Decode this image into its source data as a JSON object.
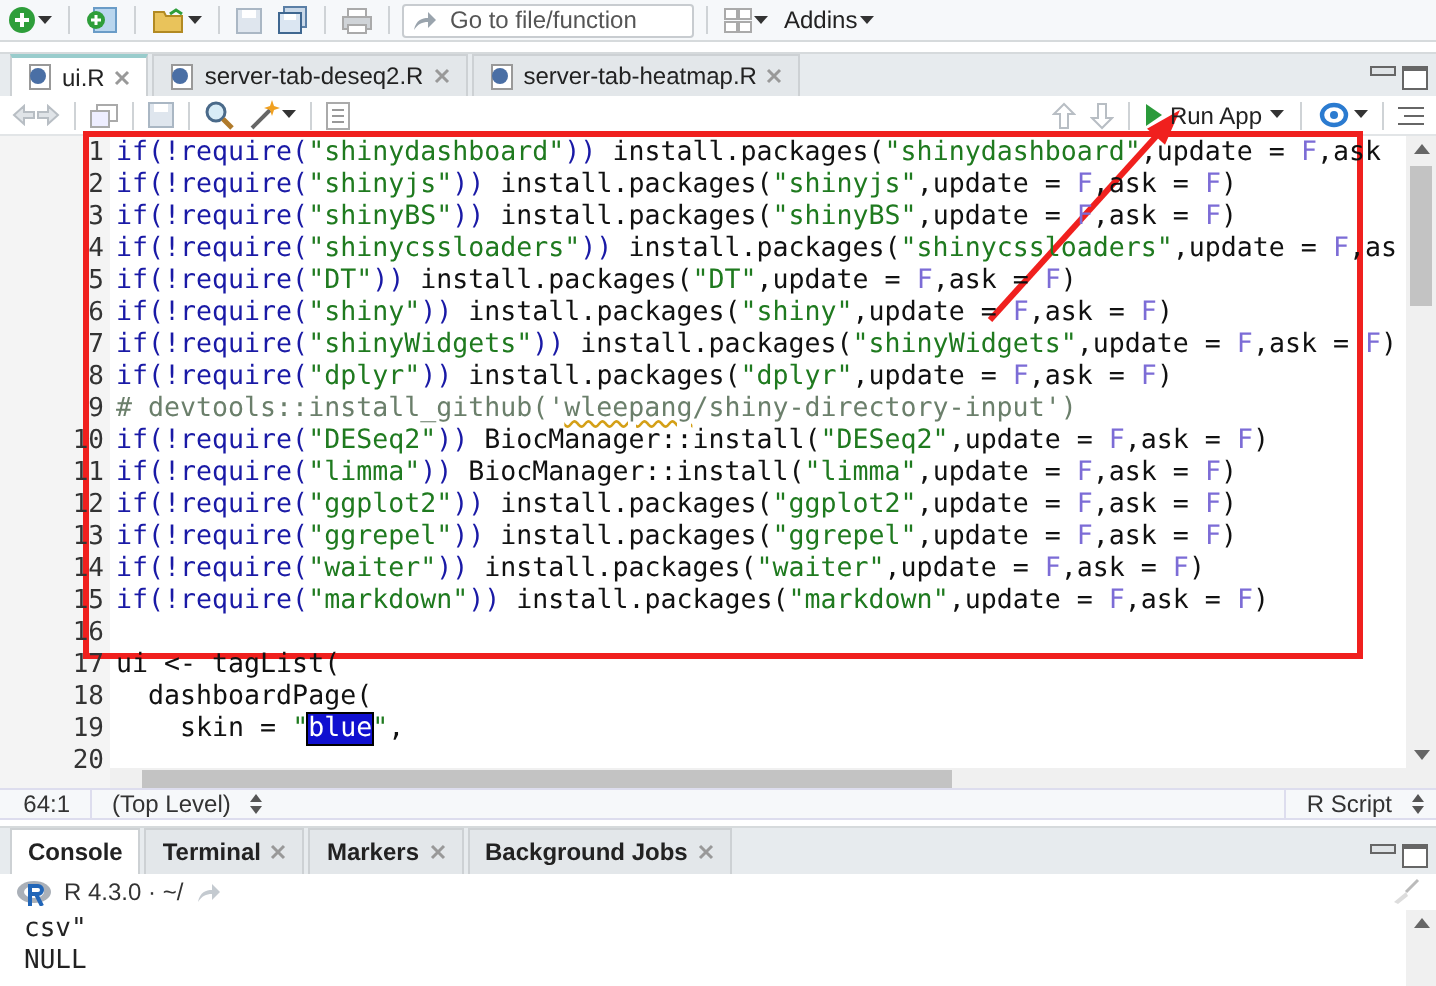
{
  "toolbar": {
    "goto_placeholder": "Go to file/function",
    "addins": "Addins"
  },
  "editor_tabs": [
    {
      "label": "ui.R",
      "selected": true
    },
    {
      "label": "server-tab-deseq2.R",
      "selected": false
    },
    {
      "label": "server-tab-heatmap.R",
      "selected": false
    }
  ],
  "editor_toolbar": {
    "run_app": "Run App"
  },
  "code_lines": [
    {
      "number": "1",
      "segments": [
        {
          "kind": "keyword",
          "text": "if(!require("
        },
        {
          "kind": "string",
          "text": "\"shinydashboard\""
        },
        {
          "kind": "keyword",
          "text": "))"
        },
        {
          "kind": "plain",
          "text": " install.packages("
        },
        {
          "kind": "string",
          "text": "\"shinydashboard\""
        },
        {
          "kind": "plain",
          "text": ",update = "
        },
        {
          "kind": "constant",
          "text": "F"
        },
        {
          "kind": "plain",
          "text": ",ask"
        }
      ]
    },
    {
      "number": "2",
      "segments": [
        {
          "kind": "keyword",
          "text": "if(!require("
        },
        {
          "kind": "string",
          "text": "\"shinyjs\""
        },
        {
          "kind": "keyword",
          "text": "))"
        },
        {
          "kind": "plain",
          "text": " install.packages("
        },
        {
          "kind": "string",
          "text": "\"shinyjs\""
        },
        {
          "kind": "plain",
          "text": ",update = "
        },
        {
          "kind": "constant",
          "text": "F"
        },
        {
          "kind": "plain",
          "text": ",ask = "
        },
        {
          "kind": "constant",
          "text": "F"
        },
        {
          "kind": "plain",
          "text": ")"
        }
      ]
    },
    {
      "number": "3",
      "segments": [
        {
          "kind": "keyword",
          "text": "if(!require("
        },
        {
          "kind": "string",
          "text": "\"shinyBS\""
        },
        {
          "kind": "keyword",
          "text": "))"
        },
        {
          "kind": "plain",
          "text": " install.packages("
        },
        {
          "kind": "string",
          "text": "\"shinyBS\""
        },
        {
          "kind": "plain",
          "text": ",update = "
        },
        {
          "kind": "constant",
          "text": "F"
        },
        {
          "kind": "plain",
          "text": ",ask = "
        },
        {
          "kind": "constant",
          "text": "F"
        },
        {
          "kind": "plain",
          "text": ")"
        }
      ]
    },
    {
      "number": "4",
      "segments": [
        {
          "kind": "keyword",
          "text": "if(!require("
        },
        {
          "kind": "string",
          "text": "\"shinycssloaders\""
        },
        {
          "kind": "keyword",
          "text": "))"
        },
        {
          "kind": "plain",
          "text": " install.packages("
        },
        {
          "kind": "string",
          "text": "\"shinycssloaders\""
        },
        {
          "kind": "plain",
          "text": ",update = "
        },
        {
          "kind": "constant",
          "text": "F"
        },
        {
          "kind": "plain",
          "text": ",as"
        }
      ]
    },
    {
      "number": "5",
      "segments": [
        {
          "kind": "keyword",
          "text": "if(!require("
        },
        {
          "kind": "string",
          "text": "\"DT\""
        },
        {
          "kind": "keyword",
          "text": "))"
        },
        {
          "kind": "plain",
          "text": " install.packages("
        },
        {
          "kind": "string",
          "text": "\"DT\""
        },
        {
          "kind": "plain",
          "text": ",update = "
        },
        {
          "kind": "constant",
          "text": "F"
        },
        {
          "kind": "plain",
          "text": ",ask = "
        },
        {
          "kind": "constant",
          "text": "F"
        },
        {
          "kind": "plain",
          "text": ")"
        }
      ]
    },
    {
      "number": "6",
      "segments": [
        {
          "kind": "keyword",
          "text": "if(!require("
        },
        {
          "kind": "string",
          "text": "\"shiny\""
        },
        {
          "kind": "keyword",
          "text": "))"
        },
        {
          "kind": "plain",
          "text": " install.packages("
        },
        {
          "kind": "string",
          "text": "\"shiny\""
        },
        {
          "kind": "plain",
          "text": ",update = "
        },
        {
          "kind": "constant",
          "text": "F"
        },
        {
          "kind": "plain",
          "text": ",ask = "
        },
        {
          "kind": "constant",
          "text": "F"
        },
        {
          "kind": "plain",
          "text": ")"
        }
      ]
    },
    {
      "number": "7",
      "segments": [
        {
          "kind": "keyword",
          "text": "if(!require("
        },
        {
          "kind": "string",
          "text": "\"shinyWidgets\""
        },
        {
          "kind": "keyword",
          "text": "))"
        },
        {
          "kind": "plain",
          "text": " install.packages("
        },
        {
          "kind": "string",
          "text": "\"shinyWidgets\""
        },
        {
          "kind": "plain",
          "text": ",update = "
        },
        {
          "kind": "constant",
          "text": "F"
        },
        {
          "kind": "plain",
          "text": ",ask = "
        },
        {
          "kind": "constant",
          "text": "F"
        },
        {
          "kind": "plain",
          "text": ")"
        }
      ]
    },
    {
      "number": "8",
      "segments": [
        {
          "kind": "keyword",
          "text": "if(!require("
        },
        {
          "kind": "string",
          "text": "\"dplyr\""
        },
        {
          "kind": "keyword",
          "text": "))"
        },
        {
          "kind": "plain",
          "text": " install.packages("
        },
        {
          "kind": "string",
          "text": "\"dplyr\""
        },
        {
          "kind": "plain",
          "text": ",update = "
        },
        {
          "kind": "constant",
          "text": "F"
        },
        {
          "kind": "plain",
          "text": ",ask = "
        },
        {
          "kind": "constant",
          "text": "F"
        },
        {
          "kind": "plain",
          "text": ")"
        }
      ]
    },
    {
      "number": "9",
      "segments": [
        {
          "kind": "comment",
          "text": "# devtools::install_github('"
        },
        {
          "kind": "misspelled",
          "text": "wleepang"
        },
        {
          "kind": "comment",
          "text": "/shiny-directory-input')"
        }
      ]
    },
    {
      "number": "10",
      "segments": [
        {
          "kind": "keyword",
          "text": "if(!require("
        },
        {
          "kind": "string",
          "text": "\"DESeq2\""
        },
        {
          "kind": "keyword",
          "text": "))"
        },
        {
          "kind": "plain",
          "text": " BiocManager::install("
        },
        {
          "kind": "string",
          "text": "\"DESeq2\""
        },
        {
          "kind": "plain",
          "text": ",update = "
        },
        {
          "kind": "constant",
          "text": "F"
        },
        {
          "kind": "plain",
          "text": ",ask = "
        },
        {
          "kind": "constant",
          "text": "F"
        },
        {
          "kind": "plain",
          "text": ")"
        }
      ]
    },
    {
      "number": "11",
      "segments": [
        {
          "kind": "keyword",
          "text": "if(!require("
        },
        {
          "kind": "string",
          "text": "\"limma\""
        },
        {
          "kind": "keyword",
          "text": "))"
        },
        {
          "kind": "plain",
          "text": " BiocManager::install("
        },
        {
          "kind": "string",
          "text": "\"limma\""
        },
        {
          "kind": "plain",
          "text": ",update = "
        },
        {
          "kind": "constant",
          "text": "F"
        },
        {
          "kind": "plain",
          "text": ",ask = "
        },
        {
          "kind": "constant",
          "text": "F"
        },
        {
          "kind": "plain",
          "text": ")"
        }
      ]
    },
    {
      "number": "12",
      "segments": [
        {
          "kind": "keyword",
          "text": "if(!require("
        },
        {
          "kind": "string",
          "text": "\"ggplot2\""
        },
        {
          "kind": "keyword",
          "text": "))"
        },
        {
          "kind": "plain",
          "text": " install.packages("
        },
        {
          "kind": "string",
          "text": "\"ggplot2\""
        },
        {
          "kind": "plain",
          "text": ",update = "
        },
        {
          "kind": "constant",
          "text": "F"
        },
        {
          "kind": "plain",
          "text": ",ask = "
        },
        {
          "kind": "constant",
          "text": "F"
        },
        {
          "kind": "plain",
          "text": ")"
        }
      ]
    },
    {
      "number": "13",
      "segments": [
        {
          "kind": "keyword",
          "text": "if(!require("
        },
        {
          "kind": "string",
          "text": "\"ggrepel\""
        },
        {
          "kind": "keyword",
          "text": "))"
        },
        {
          "kind": "plain",
          "text": " install.packages("
        },
        {
          "kind": "string",
          "text": "\"ggrepel\""
        },
        {
          "kind": "plain",
          "text": ",update = "
        },
        {
          "kind": "constant",
          "text": "F"
        },
        {
          "kind": "plain",
          "text": ",ask = "
        },
        {
          "kind": "constant",
          "text": "F"
        },
        {
          "kind": "plain",
          "text": ")"
        }
      ]
    },
    {
      "number": "14",
      "segments": [
        {
          "kind": "keyword",
          "text": "if(!require("
        },
        {
          "kind": "string",
          "text": "\"waiter\""
        },
        {
          "kind": "keyword",
          "text": "))"
        },
        {
          "kind": "plain",
          "text": " install.packages("
        },
        {
          "kind": "string",
          "text": "\"waiter\""
        },
        {
          "kind": "plain",
          "text": ",update = "
        },
        {
          "kind": "constant",
          "text": "F"
        },
        {
          "kind": "plain",
          "text": ",ask = "
        },
        {
          "kind": "constant",
          "text": "F"
        },
        {
          "kind": "plain",
          "text": ")"
        }
      ]
    },
    {
      "number": "15",
      "segments": [
        {
          "kind": "keyword",
          "text": "if(!require("
        },
        {
          "kind": "string",
          "text": "\"markdown\""
        },
        {
          "kind": "keyword",
          "text": "))"
        },
        {
          "kind": "plain",
          "text": " install.packages("
        },
        {
          "kind": "string",
          "text": "\"markdown\""
        },
        {
          "kind": "plain",
          "text": ",update = "
        },
        {
          "kind": "constant",
          "text": "F"
        },
        {
          "kind": "plain",
          "text": ",ask = "
        },
        {
          "kind": "constant",
          "text": "F"
        },
        {
          "kind": "plain",
          "text": ")"
        }
      ]
    },
    {
      "number": "16"
    },
    {
      "number": "17",
      "segments": [
        {
          "kind": "plain",
          "text": "ui <- tagList("
        }
      ]
    },
    {
      "number": "18",
      "segments": [
        {
          "kind": "plain",
          "text": "  dashboardPage("
        }
      ]
    },
    {
      "number": "19",
      "segments": [
        {
          "kind": "plain",
          "text": "    skin = "
        },
        {
          "kind": "string",
          "text": "\""
        },
        {
          "kind": "selected",
          "text": "blue"
        },
        {
          "kind": "string",
          "text": "\""
        },
        {
          "kind": "plain",
          "text": ","
        }
      ]
    },
    {
      "number": "20"
    }
  ],
  "status_bar": {
    "position": "64:1",
    "scope": "(Top Level)",
    "file_type": "R Script"
  },
  "console_tabs": [
    {
      "label": "Console",
      "selected": true
    },
    {
      "label": "Terminal",
      "selected": false
    },
    {
      "label": "Markers",
      "selected": false
    },
    {
      "label": "Background Jobs",
      "selected": false
    }
  ],
  "console": {
    "location": "R 4.3.0 · ~/",
    "lines": [
      "csv\"",
      "NULL"
    ]
  }
}
